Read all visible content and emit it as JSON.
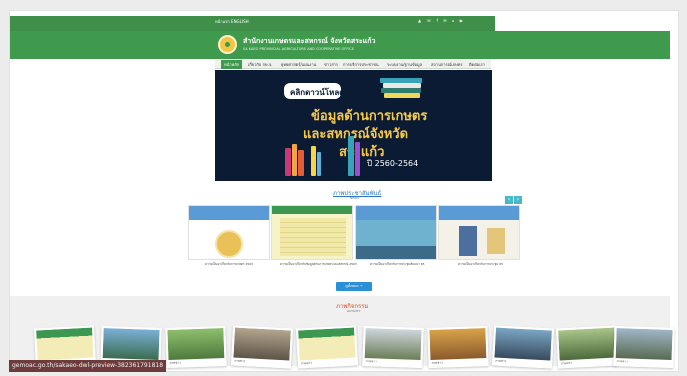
{
  "topbar": {
    "left_links": "หน้าแรก   ENGLISH",
    "right_icons": "▲  ☏  f  ✉  ⌂  ▶"
  },
  "header": {
    "org_name_th": "สำนักงานเกษตรและสหกรณ์ จังหวัดสระแก้ว",
    "org_name_en": "SA KAEO PROVINCIAL AGRICULTURE AND COOPERATIVE OFFICE"
  },
  "nav": {
    "items": [
      "หน้าหลัก",
      "เกี่ยวกับ กษ.จ.",
      "ยุทธศาสตร์/แผนงาน",
      "ข่าวสาร",
      "การบริการประชาชน",
      "ระบบงาน/ฐานข้อมูล",
      "สถานการณ์เกษตร",
      "ติดต่อเรา"
    ]
  },
  "banner": {
    "pill": "คลิกดาวน์โหลด",
    "line1": "ข้อมูลด้านการเกษตร",
    "line2": "และสหกรณ์จังหวัด",
    "line3": "สระแก้ว",
    "years": "ปี 2560-2564",
    "accent": "#f7c84a",
    "bg": "#0a1b33"
  },
  "pr": {
    "title": "ภาพประชาสัมพันธ์",
    "subtitle": "NEWS",
    "prev": "‹",
    "next": "›",
    "cards": [
      {
        "caption": "ความเป็นมาเกี่ยวกับการเกษตร 2563"
      },
      {
        "caption": "ความเป็นมาเกี่ยวกับข้อมูลด้านการเกษตรและสหกรณ์ 2563"
      },
      {
        "caption": "ความเป็นมาเกี่ยวกับการประชุมสัมมนา 65"
      },
      {
        "caption": "ความเป็นมาเกี่ยวกับการประชุม 65"
      }
    ],
    "more_button": "ดูทั้งหมด →"
  },
  "gallery": {
    "title": "ภาพกิจกรรม",
    "subtitle": "ACTIVITY",
    "photos": [
      {
        "caption": "ภาพข่าว"
      },
      {
        "caption": "ภาพข่าว"
      },
      {
        "caption": "ภาพข่าว"
      },
      {
        "caption": "ภาพข่าว"
      },
      {
        "caption": "ภาพข่าว"
      },
      {
        "caption": "ภาพข่าว"
      },
      {
        "caption": "ภาพข่าว"
      },
      {
        "caption": "ภาพข่าว"
      },
      {
        "caption": "ภาพข่าว"
      },
      {
        "caption": "ภาพข่าว"
      }
    ]
  },
  "status_bar": {
    "url": "gemoac.go.th/sakaeo-dwl-preview-382361791818"
  },
  "colors": {
    "header_green": "#3f9a4d",
    "link_blue": "#2b7ac0",
    "activity_orange": "#d9532b",
    "button_blue": "#2a8fd6"
  }
}
